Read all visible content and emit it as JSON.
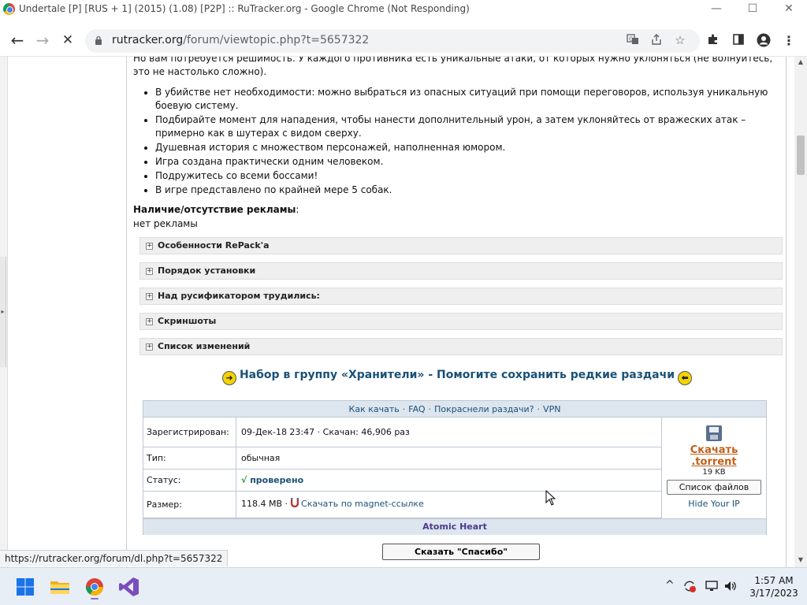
{
  "window": {
    "title": "Undertale [P] [RUS + 1] (2015) (1.08) [P2P] :: RuTracker.org - Google Chrome (Not Responding)",
    "minimize": "—",
    "maximize": "☐",
    "close": "✕"
  },
  "toolbar": {
    "back": "←",
    "forward": "→",
    "stop": "✕",
    "url_host": "rutracker.org",
    "url_path": "/forum/viewtopic.php?t=5657322",
    "translate_icon": "translate-icon",
    "share_icon": "share-icon",
    "bookmark_icon": "star-icon",
    "extensions_icon": "puzzle-icon",
    "sidepanel_icon": "side-panel-icon",
    "profile_icon": "profile-icon",
    "menu_icon": "kebab-menu-icon"
  },
  "post": {
    "intro": "Но вам потребуется решимость. У каждого противника есть уникальные атаки, от которых нужно уклоняться (не волнуйтесь, это не настолько сложно).",
    "features": [
      "В убийстве нет необходимости: можно выбраться из опасных ситуаций при помощи переговоров, используя уникальную боевую систему.",
      "Подбирайте момент для нападения, чтобы нанести дополнительный урон, а затем уклоняйтесь от вражеских атак – примерно как в шутерах с видом сверху.",
      "Душевная история с множеством персонажей, наполненная юмором.",
      "Игра создана практически одним человеком.",
      "Подружитесь со всеми боссами!",
      "В игре представлено по крайней мере 5 собак."
    ],
    "ads_heading": "Наличие/отсутствие рекламы",
    "ads_colon": ":",
    "ads_value": "нет рекламы",
    "spoilers": [
      "Особенности RePack'a",
      "Порядок установки",
      "Над русификатором трудились:",
      "Скриншоты",
      "Список изменений"
    ],
    "spoiler_toggle": "+",
    "keepers_text": "Набор в группу «Хранители» - Помогите сохранить редкие раздачи",
    "keepers_arrow_left": "➜",
    "keepers_arrow_right": "⬅"
  },
  "torrent": {
    "links": [
      "Как качать",
      "FAQ",
      "Покраснели раздачи?",
      "VPN"
    ],
    "link_sep": "·",
    "rows": {
      "registered_label": "Зарегистрирован:",
      "registered_value": "09-Дек-18 23:47",
      "registered_sep": "·",
      "downloads": "Скачан: 46,906 раз",
      "type_label": "Тип:",
      "type_value": "обычная",
      "status_label": "Статус:",
      "status_check": "√",
      "status_value": "проверено",
      "size_label": "Размер:",
      "size_value": "118.4 MB",
      "size_sep": "·",
      "magnet_icon": "magnet-icon",
      "magnet_link": "Скачать по magnet-ссылке"
    },
    "download_line1": "Скачать",
    "download_line2": ".torrent",
    "torrent_size": "19 KB",
    "file_list_button": "Список файлов",
    "hide_ip": "Hide Your IP",
    "footer_title": "Atomic Heart"
  },
  "thanks_button": "Сказать \"Спасибо\"",
  "status_bar_url": "https://rutracker.org/forum/dl.php?t=5657322",
  "taskbar": {
    "apps": [
      "windows-start-icon",
      "file-explorer-icon",
      "chrome-icon",
      "visual-studio-icon"
    ],
    "tray_chevron": "^",
    "clock_time": "1:57 AM",
    "clock_date": "3/17/2023"
  },
  "colors": {
    "link": "#1a5178",
    "download_link": "#c0601a",
    "status_ok": "#1a5178",
    "check_green": "#2a8a2a",
    "table_header_bg": "#dde5ee"
  }
}
